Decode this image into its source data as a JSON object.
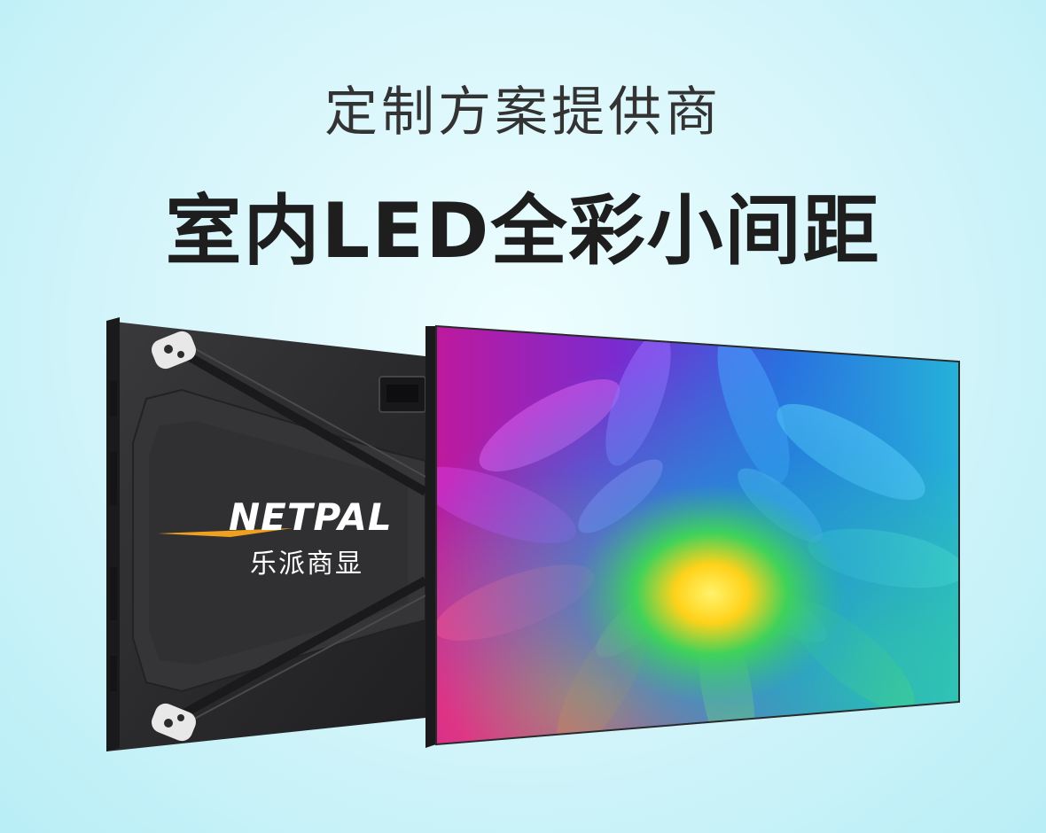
{
  "headline": {
    "line1": "定制方案提供商",
    "line2": "室内LED全彩小间距"
  },
  "product": {
    "brand_logo": "NETPAL",
    "brand_subtitle": "乐派商显"
  },
  "colors": {
    "background": "#d8f6fb",
    "headline_text": "#2a2a2a",
    "cabinet": "#2e2e30",
    "logo_swoosh": "#f0a020"
  }
}
